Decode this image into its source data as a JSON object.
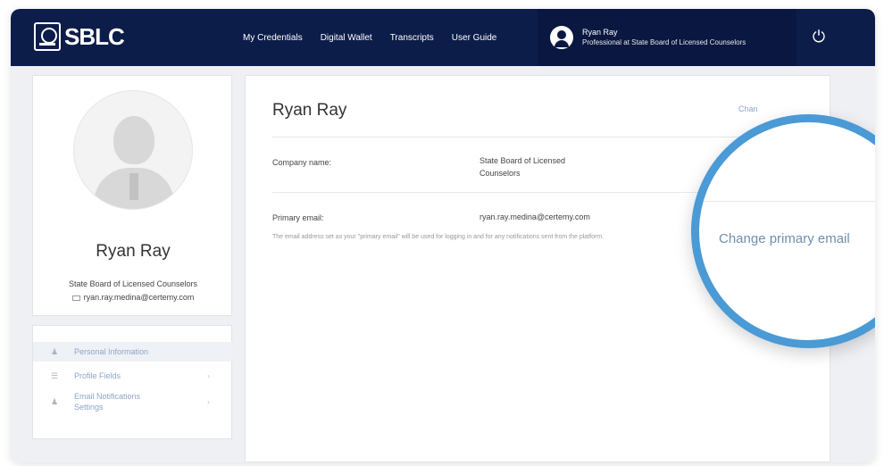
{
  "header": {
    "logo_text": "SBLC",
    "nav": [
      "My Credentials",
      "Digital Wallet",
      "Transcripts",
      "User Guide"
    ],
    "user_name": "Ryan Ray",
    "user_role": "Professional at State Board of Licensed Counselors",
    "power_icon": "power-icon",
    "bg_color": "#0d1d4a"
  },
  "profile": {
    "name": "Ryan Ray",
    "org": "State Board of Licensed Counselors",
    "email": "ryan.ray.medina@certemy.com"
  },
  "menu": {
    "items": [
      "Personal Information",
      "Profile Fields",
      "Email Notifications Settings"
    ]
  },
  "main": {
    "title": "Ryan Ray",
    "change_link": "Chan",
    "company_label": "Company name:",
    "company_value": "State Board of Licensed Counselors",
    "email_label": "Primary email:",
    "email_value": "ryan.ray.medina@certemy.com",
    "email_note": "The email address set as your \"primary email\" will be used for logging in and for any notifications sent from the platform."
  },
  "magnifier": {
    "text": "Change primary email",
    "accent": "#4a9ad6"
  }
}
